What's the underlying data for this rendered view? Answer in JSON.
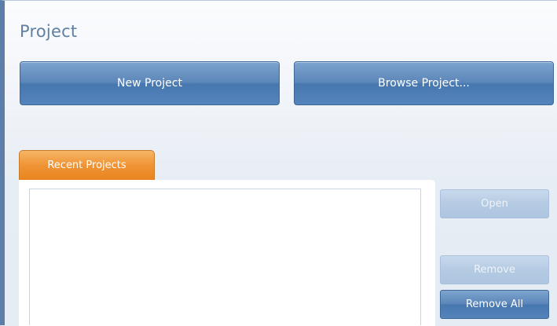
{
  "project": {
    "title": "Project",
    "new_project_label": "New Project",
    "browse_project_label": "Browse Project..."
  },
  "recent": {
    "tab_label": "Recent Projects",
    "items": [],
    "open_label": "Open",
    "remove_label": "Remove",
    "remove_all_label": "Remove All"
  },
  "colors": {
    "accent_blue": "#4d7db5",
    "tab_orange": "#ef9435",
    "title_blue": "#5f7fa3"
  }
}
